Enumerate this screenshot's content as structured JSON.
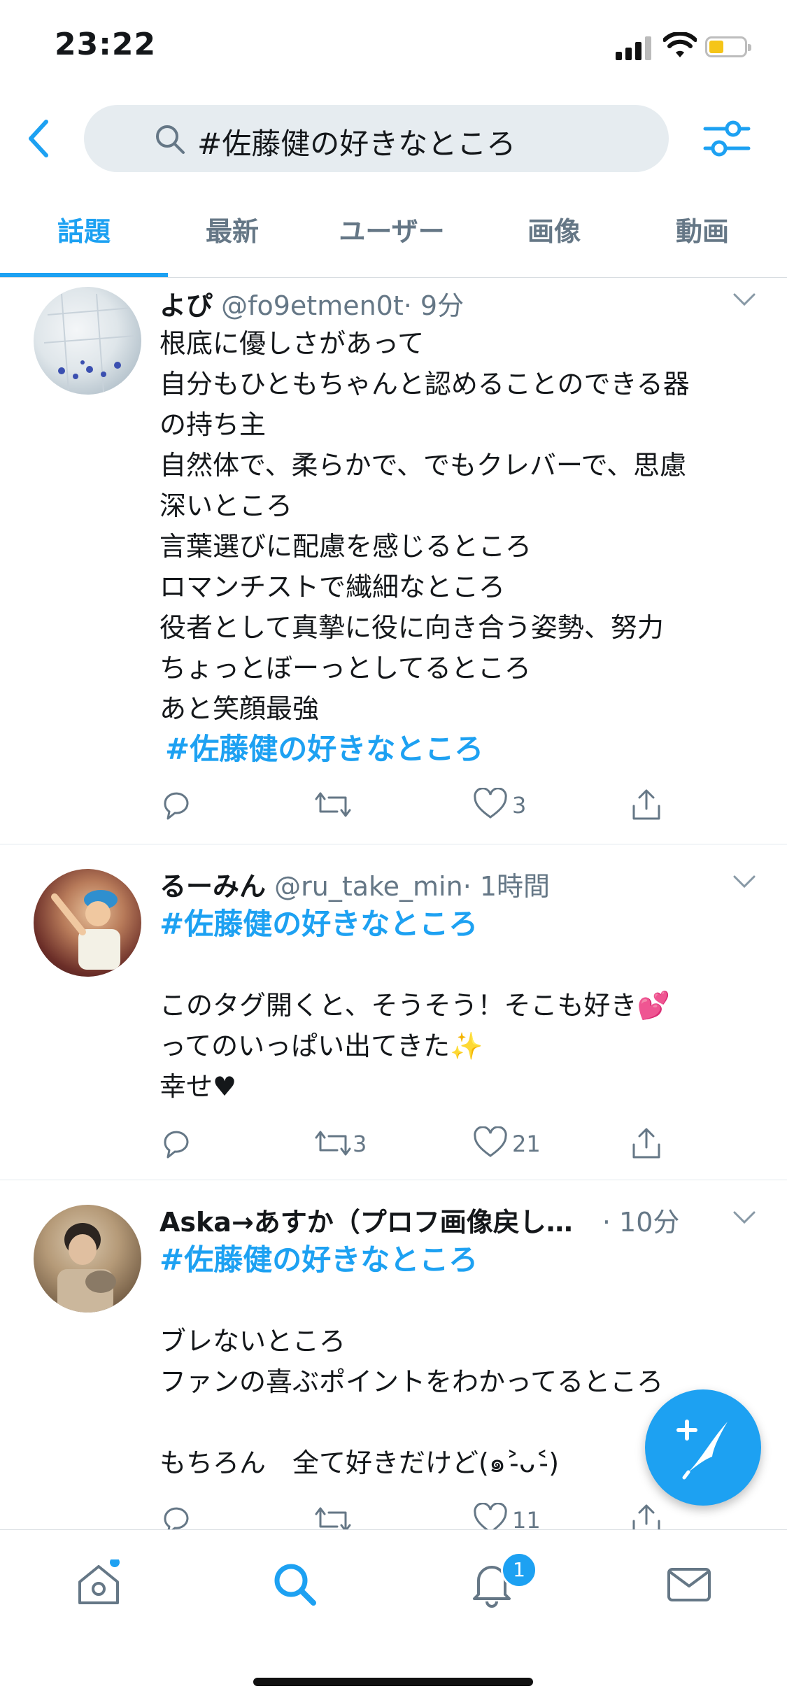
{
  "status_bar": {
    "time": "23:22"
  },
  "search": {
    "query": "#佐藤健の好きなところ"
  },
  "tabs": [
    {
      "label": "話題",
      "active": true
    },
    {
      "label": "最新"
    },
    {
      "label": "ユーザー"
    },
    {
      "label": "画像"
    },
    {
      "label": "動画"
    }
  ],
  "tweets": [
    {
      "name": "よぴ",
      "handle": "@fo9etmen0t",
      "time": "· 9分",
      "lines": [
        "根底に優しさがあって",
        "自分もひともちゃんと認めることのできる器",
        "の持ち主",
        "自然体で、柔らかで、でもクレバーで、思慮",
        "深いところ",
        "言葉選びに配慮を感じるところ",
        "ロマンチストで繊細なところ",
        "役者として真摯に役に向き合う姿勢、努力",
        "ちょっとぼーっとしてるところ",
        "あと笑顔最強"
      ],
      "hashtag": "#佐藤健の好きなところ",
      "retweets": "",
      "likes": "3"
    },
    {
      "name": "るーみん",
      "handle": "@ru_take_min",
      "time": "· 1時間",
      "hashtag": "#佐藤健の好きなところ",
      "lines": [
        "このタグ開くと、そうそう！そこも好き💕",
        "ってのいっぱい出てきた✨",
        "幸せ♥"
      ],
      "retweets": "3",
      "likes": "21"
    },
    {
      "name": "Aska→あすか（プロフ画像戻し…",
      "handle": "",
      "time": "· 10分",
      "hashtag": "#佐藤健の好きなところ",
      "lines": [
        "ブレないところ",
        "ファンの喜ぶポイントをわかってるところ",
        "",
        "もちろん　全て好きだけど(๑˃̵ᴗ˂̵)"
      ],
      "retweets": "",
      "likes": "11"
    }
  ],
  "nav": {
    "notifications_badge": "1"
  },
  "colors": {
    "accent": "#1da1f2",
    "text": "#14171a",
    "muted": "#657786"
  }
}
